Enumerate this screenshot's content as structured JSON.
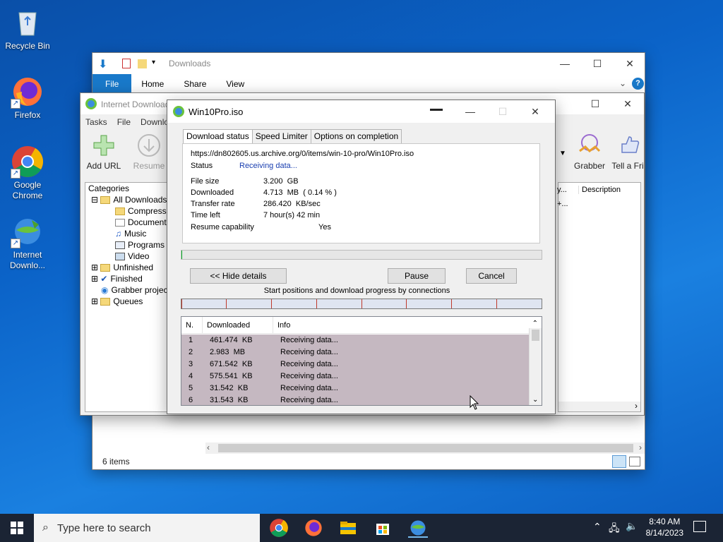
{
  "desktop": {
    "icons": [
      {
        "label": "Recycle Bin"
      },
      {
        "label": "Firefox"
      },
      {
        "label": "Google Chrome"
      },
      {
        "label": "Internet Downlo..."
      }
    ]
  },
  "explorer": {
    "title": "Downloads",
    "tabs": [
      "File",
      "Home",
      "Share",
      "View"
    ],
    "status": "6 items"
  },
  "idm": {
    "title": "Internet Download",
    "menu": [
      "Tasks",
      "File",
      "Downlo"
    ],
    "toolbar": {
      "add_url": "Add URL",
      "resume": "Resume",
      "grabber": "Grabber",
      "tell": "Tell a Fri"
    },
    "categories_header": "Categories",
    "categories": [
      "All Downloads",
      "Compresse",
      "Documents",
      "Music",
      "Programs",
      "Video",
      "Unfinished",
      "Finished",
      "Grabber projec",
      "Queues"
    ],
    "list_headers": [
      "y...",
      "Description"
    ],
    "list_cell": "+..."
  },
  "dialog": {
    "title": "Win10Pro.iso",
    "tabs": [
      "Download status",
      "Speed Limiter",
      "Options on completion"
    ],
    "url": "https://dn802605.us.archive.org/0/items/win-10-pro/Win10Pro.iso",
    "status_label": "Status",
    "status_value": "Receiving data...",
    "file_size_label": "File size",
    "file_size": "3.200  GB",
    "downloaded_label": "Downloaded",
    "downloaded": "4.713  MB  ( 0.14 % )",
    "transfer_label": "Transfer rate",
    "transfer": "286.420  KB/sec",
    "time_left_label": "Time left",
    "time_left": "7 hour(s) 42 min",
    "resume_label": "Resume capability",
    "resume": "Yes",
    "progress_percent": 0.14,
    "buttons": {
      "hide": "<< Hide details",
      "pause": "Pause",
      "cancel": "Cancel"
    },
    "connections_caption": "Start positions and download progress by connections",
    "table_headers": [
      "N.",
      "Downloaded",
      "Info"
    ],
    "rows": [
      {
        "n": "1",
        "downloaded": "461.474  KB",
        "info": "Receiving data..."
      },
      {
        "n": "2",
        "downloaded": "2.983  MB",
        "info": "Receiving data..."
      },
      {
        "n": "3",
        "downloaded": "671.542  KB",
        "info": "Receiving data..."
      },
      {
        "n": "4",
        "downloaded": "575.541  KB",
        "info": "Receiving data..."
      },
      {
        "n": "5",
        "downloaded": "31.542  KB",
        "info": "Receiving data..."
      },
      {
        "n": "6",
        "downloaded": "31.543  KB",
        "info": "Receiving data..."
      }
    ]
  },
  "taskbar": {
    "search_placeholder": "Type here to search",
    "time": "8:40 AM",
    "date": "8/14/2023"
  },
  "colors": {
    "accent": "#1979ca",
    "status_blue": "#1a3fb0",
    "row_bg": "#c5b8c1"
  }
}
